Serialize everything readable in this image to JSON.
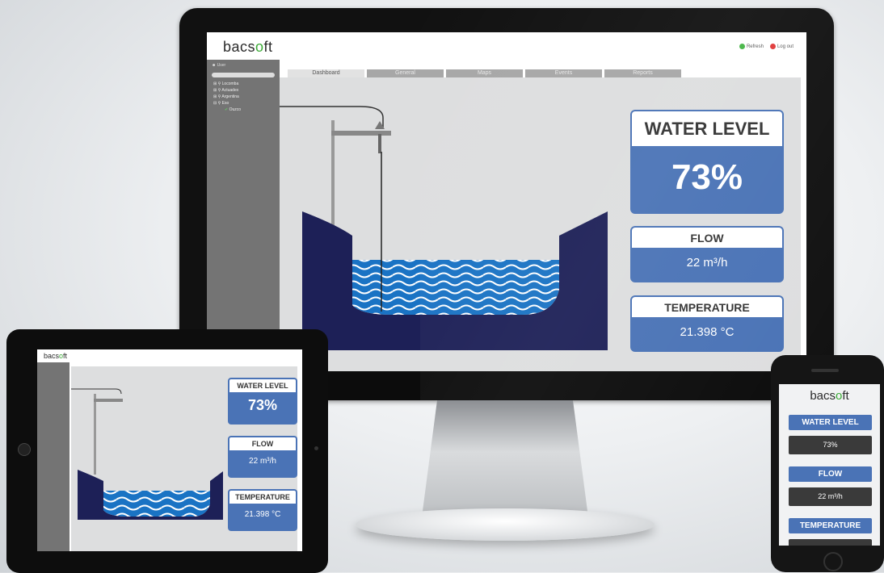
{
  "brand": {
    "logo_text": "bacs",
    "logo_o": "o",
    "logo_tail": "ft",
    "accent": "#4a73b6",
    "water": "#1a73c4",
    "tank": "#1d2057"
  },
  "header": {
    "refresh_label": "Refresh",
    "logout_label": "Log out"
  },
  "sidebar": {
    "user_label": "User",
    "tree": [
      "Locomba",
      "Actuadex",
      "Argentina",
      "Eso",
      "Ouzco"
    ]
  },
  "tabs": [
    "Dashboard",
    "General",
    "Maps",
    "Events",
    "Reports"
  ],
  "metrics": {
    "water_level": {
      "title": "WATER LEVEL",
      "value": "73%",
      "level_fraction": 0.73
    },
    "flow": {
      "title": "FLOW",
      "value": "22 m³/h"
    },
    "temperature": {
      "title": "TEMPERATURE",
      "value": "21.398 °C"
    }
  },
  "phone": {
    "water_level_value": "73%",
    "flow_value": "22 m³/h"
  },
  "icons": [
    "user-icon",
    "refresh-icon",
    "logout-icon",
    "map-pin-icon",
    "check-icon"
  ]
}
